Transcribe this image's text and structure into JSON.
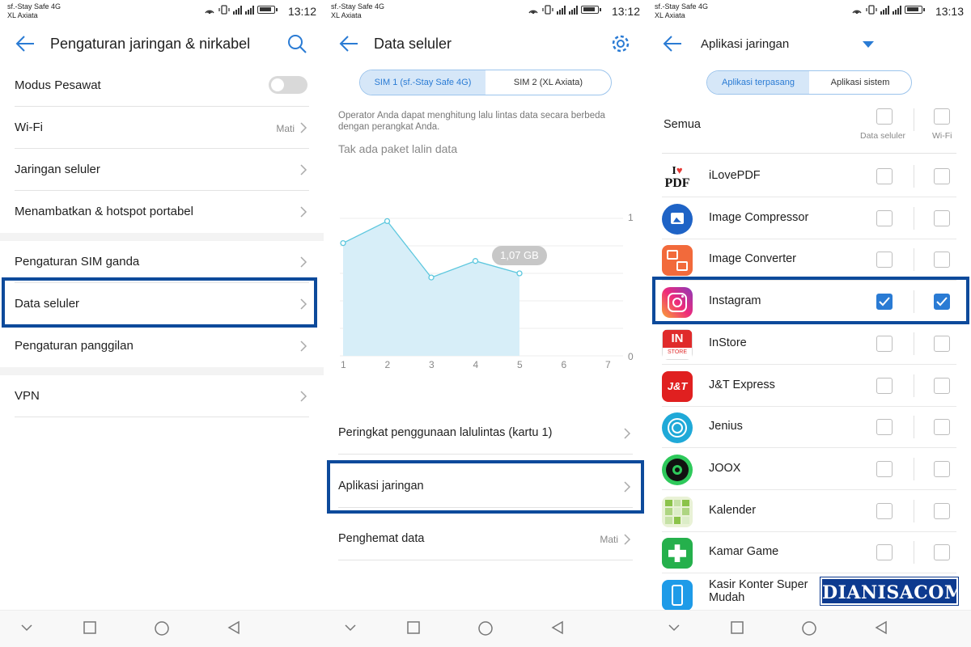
{
  "status_left": {
    "carrier1": "sf.-Stay Safe 4G",
    "carrier2": "XL Axiata",
    "time": "13:12"
  },
  "status_mid": {
    "carrier1": "sf.-Stay Safe 4G",
    "carrier2": "XL Axiata",
    "time": "13:12"
  },
  "status_right": {
    "carrier1": "sf.-Stay Safe 4G",
    "carrier2": "XL Axiata",
    "time": "13:13"
  },
  "colors": {
    "accent": "#2a7bd4",
    "highlight_border": "#0d4a9b",
    "watermark_bg": "#0d3a8f"
  },
  "panel1": {
    "title": "Pengaturan jaringan & nirkabel",
    "items": [
      {
        "label": "Modus Pesawat",
        "toggle": false
      },
      {
        "label": "Wi-Fi",
        "value": "Mati"
      },
      {
        "label": "Jaringan seluler"
      },
      {
        "label": "Menambatkan & hotspot portabel"
      },
      {
        "label": "Pengaturan SIM ganda"
      },
      {
        "label": "Data seluler",
        "highlighted": true
      },
      {
        "label": "Pengaturan panggilan"
      },
      {
        "label": "VPN"
      }
    ]
  },
  "panel2": {
    "title": "Data seluler",
    "sim_tabs": [
      "SIM 1 (sf.-Stay Safe 4G)",
      "SIM 2 (XL Axiata)"
    ],
    "note": "Operator Anda dapat menghitung lalu lintas data secara berbeda dengan perangkat Anda.",
    "no_package": "Tak ada paket lalin data",
    "items": [
      {
        "label": "Peringkat penggunaan lalulintas (kartu 1)"
      },
      {
        "label": "Aplikasi jaringan",
        "highlighted": true
      },
      {
        "label": "Penghemat data",
        "value": "Mati"
      }
    ]
  },
  "chart_data": {
    "type": "area",
    "x": [
      1,
      2,
      3,
      4,
      5,
      6,
      7
    ],
    "x_ticks": [
      "1",
      "2",
      "3",
      "4",
      "5",
      "6",
      "7"
    ],
    "y_ticks": [
      "1",
      "0"
    ],
    "ylim": [
      0,
      1
    ],
    "series": [
      {
        "values": [
          0.82,
          0.98,
          0.57,
          0.69,
          0.6
        ]
      }
    ],
    "tooltip": "1,07 GB",
    "grid": true
  },
  "panel3": {
    "title": "Aplikasi jaringan",
    "tabs": [
      "Aplikasi terpasang",
      "Aplikasi sistem"
    ],
    "all_label": "Semua",
    "col_data": "Data seluler",
    "col_wifi": "Wi-Fi",
    "apps": [
      {
        "name": "iLovePDF",
        "icon": "ilovepdf-icon",
        "data": false,
        "wifi": false
      },
      {
        "name": "Image Compressor",
        "icon": "image-compressor-icon",
        "data": false,
        "wifi": false
      },
      {
        "name": "Image Converter",
        "icon": "image-converter-icon",
        "data": false,
        "wifi": false
      },
      {
        "name": "Instagram",
        "icon": "instagram-icon",
        "data": true,
        "wifi": true
      },
      {
        "name": "InStore",
        "icon": "instore-icon",
        "data": false,
        "wifi": false
      },
      {
        "name": "J&T Express",
        "icon": "jnt-express-icon",
        "data": false,
        "wifi": false
      },
      {
        "name": "Jenius",
        "icon": "jenius-icon",
        "data": false,
        "wifi": false
      },
      {
        "name": "JOOX",
        "icon": "joox-icon",
        "data": false,
        "wifi": false
      },
      {
        "name": "Kalender",
        "icon": "calendar-icon",
        "data": false,
        "wifi": false
      },
      {
        "name": "Kamar Game",
        "icon": "game-room-icon",
        "data": false,
        "wifi": false
      },
      {
        "name": "Kasir Konter Super Mudah",
        "icon": "kasir-konter-icon",
        "data": false,
        "wifi": false
      }
    ],
    "instore_sub": "STORE",
    "jnt_text": "J&T",
    "ilovepdf_top": "I",
    "ilovepdf_bottom": "PDF",
    "instore_top": "IN"
  },
  "watermark": "DIANISACOM"
}
